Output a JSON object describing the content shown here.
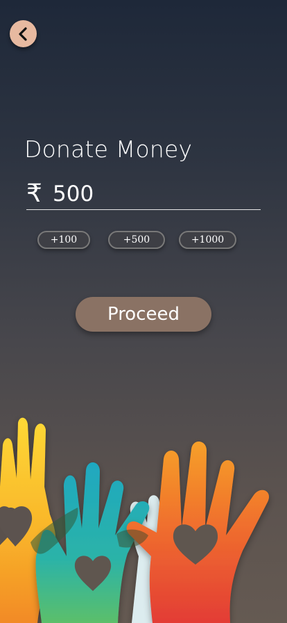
{
  "header": {
    "back_icon": "chevron-left-icon"
  },
  "donation": {
    "title": "Donate Money",
    "currency_symbol": "₹",
    "amount": "500"
  },
  "quick_add": [
    {
      "label": "+100"
    },
    {
      "label": "+500"
    },
    {
      "label": "+1000"
    }
  ],
  "actions": {
    "proceed_label": "Proceed"
  },
  "illustration": {
    "name": "helping-hands-with-hearts",
    "colors": {
      "yellow_hand": "#f9c62a",
      "teal_hand": "#2bb3b1",
      "red_hand": "#ea4a33",
      "white_hand": "#dff0f2"
    }
  },
  "colors": {
    "background_top": "#1e2839",
    "background_bottom": "#655a52",
    "back_button": "#e7b9a0",
    "proceed_button": "#8a7264",
    "chip_border": "#797979"
  }
}
